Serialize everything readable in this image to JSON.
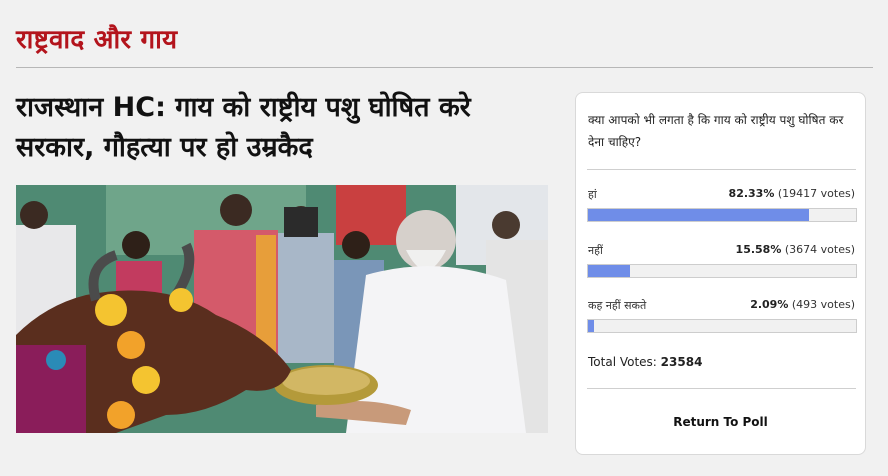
{
  "section": {
    "title": "राष्ट्रवाद और गाय"
  },
  "article": {
    "headline_line1": "राजस्थान HC: गाय को राष्ट्रीय पशु घोषित करे",
    "headline_line2": "सरकार, गौहत्या पर हो उम्रकैद",
    "image_icon": "news-photo-man-feeding-cow"
  },
  "poll": {
    "question": "क्या आपको भी लगता है कि गाय को राष्ट्रीय पशु घोषित कर देना चाहिए?",
    "options": [
      {
        "label": "हां",
        "percent": "82.33%",
        "votes": "(19417 votes)",
        "fill_fraction": 0.8233
      },
      {
        "label": "नहीं",
        "percent": "15.58%",
        "votes": "(3674 votes)",
        "fill_fraction": 0.1558
      },
      {
        "label": "कह नहीं सकते",
        "percent": "2.09%",
        "votes": "(493 votes)",
        "fill_fraction": 0.0209
      }
    ],
    "total_label": "Total Votes:",
    "total_value": "23584",
    "return_label": "Return To Poll"
  },
  "colors": {
    "section_title": "#b3141c",
    "bar_fill": "#6f8de8",
    "bar_track": "#f1f1f1",
    "page_bg": "#f1f1f1"
  }
}
